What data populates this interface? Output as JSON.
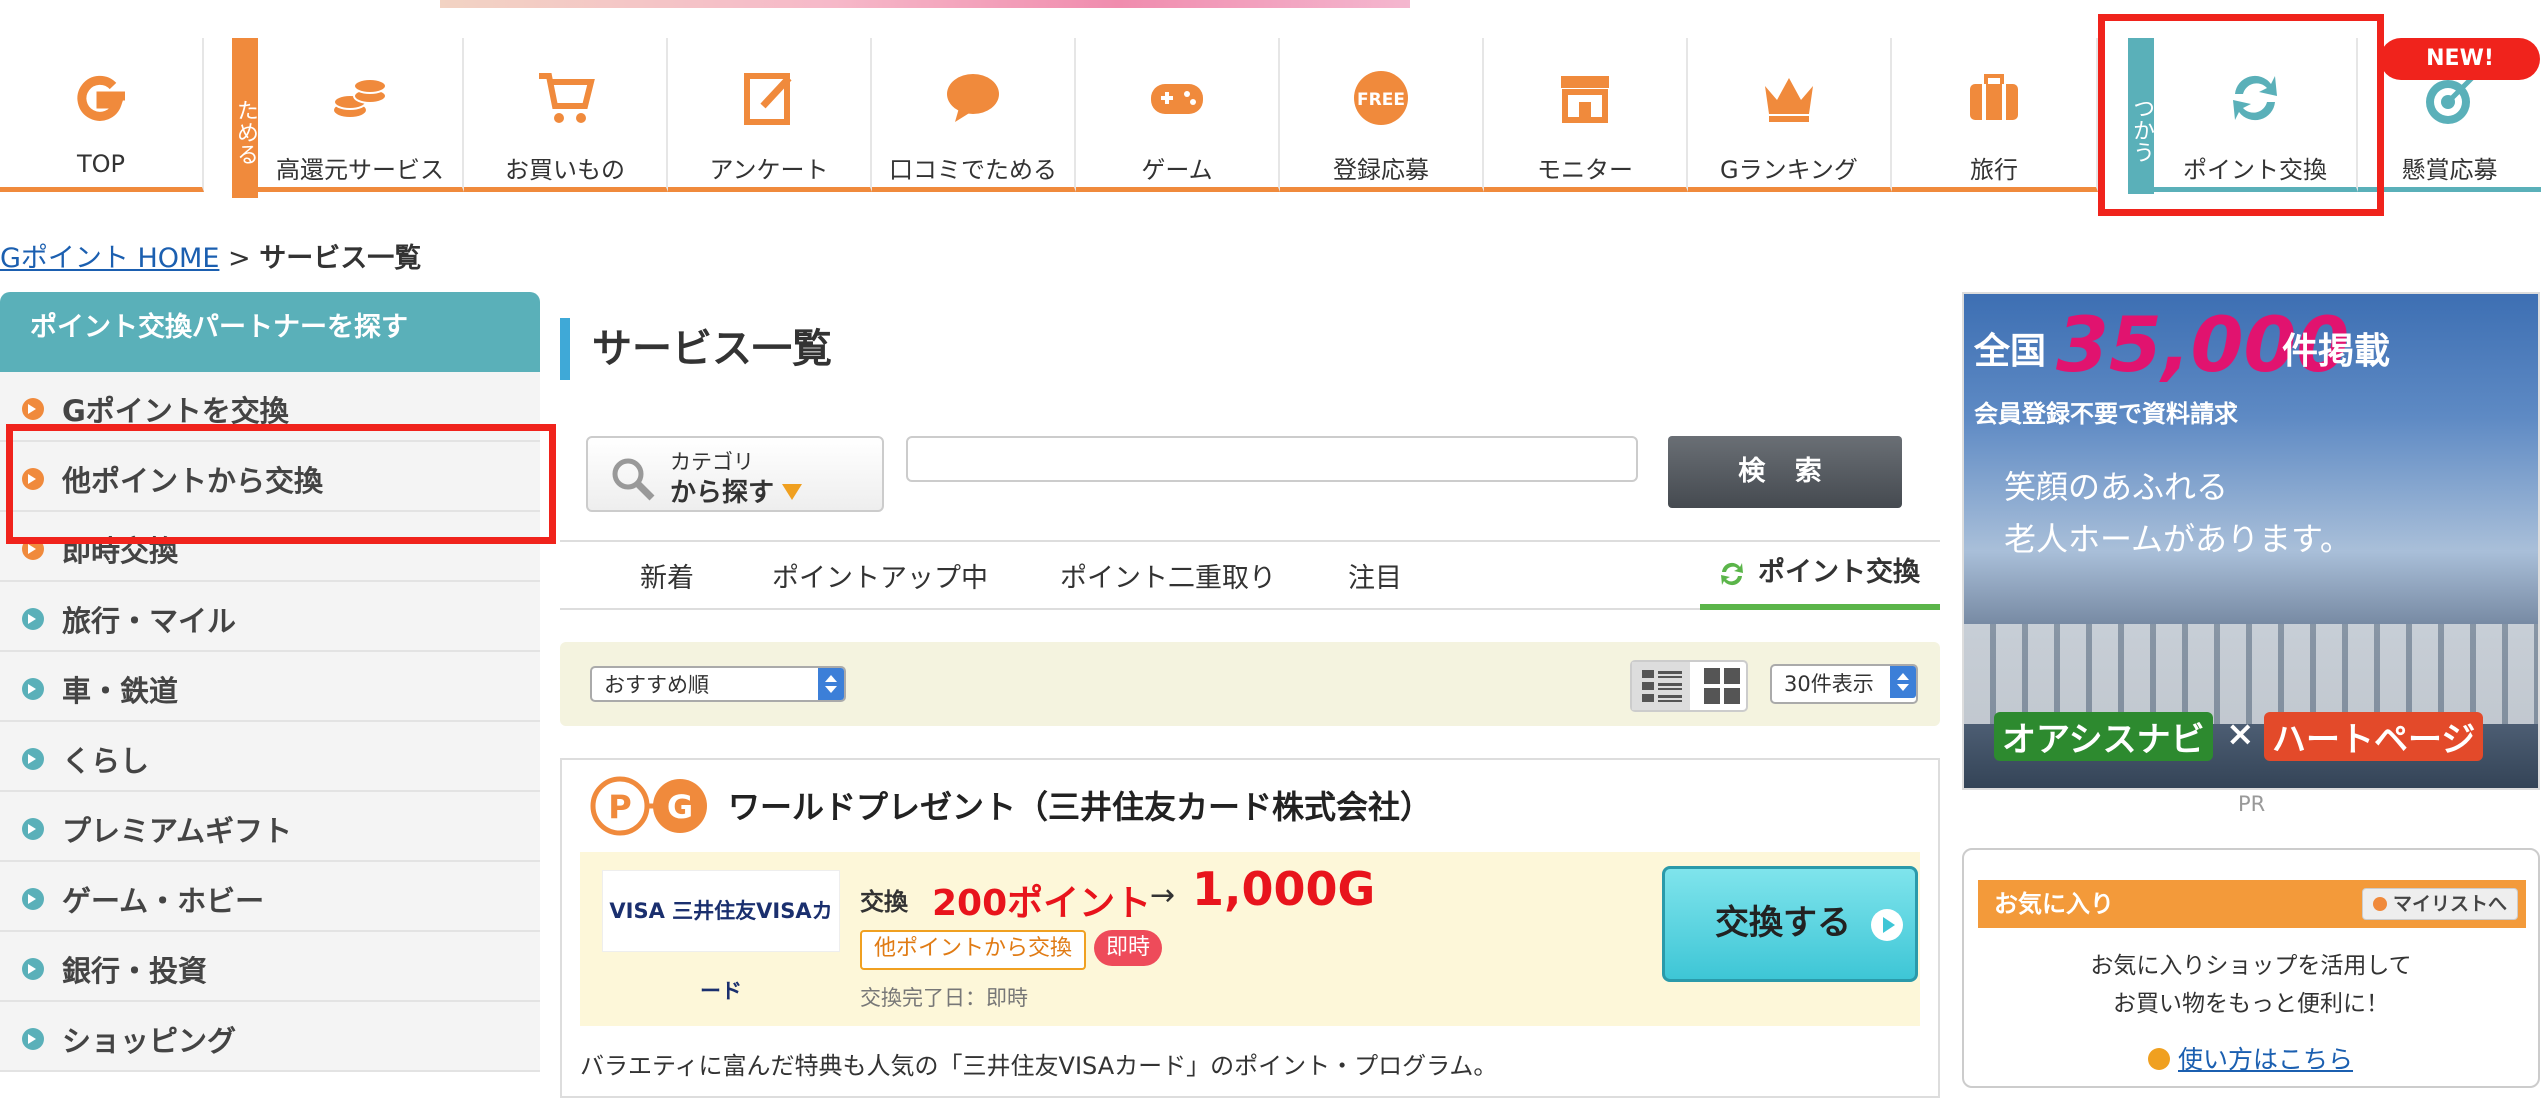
{
  "nav": {
    "top": "TOP",
    "tameru_tab": "ためる",
    "tsukau_tab": "つかう",
    "new_badge": "NEW!",
    "items": [
      {
        "label": "高還元サービス",
        "icon": "coins-icon"
      },
      {
        "label": "お買いもの",
        "icon": "cart-icon"
      },
      {
        "label": "アンケート",
        "icon": "survey-icon"
      },
      {
        "label": "口コミでためる",
        "icon": "speech-bubble-icon"
      },
      {
        "label": "ゲーム",
        "icon": "gamepad-icon"
      },
      {
        "label": "登録応募",
        "icon": "free-icon"
      },
      {
        "label": "モニター",
        "icon": "shop-icon"
      },
      {
        "label": "Gランキング",
        "icon": "crown-icon"
      },
      {
        "label": "旅行",
        "icon": "suitcase-icon"
      }
    ],
    "exchange": "ポイント交換",
    "prize": "懸賞応募",
    "free_text": "FREE"
  },
  "breadcrumb": {
    "home": "Gポイント HOME",
    "sep": " > ",
    "current": "サービス一覧"
  },
  "sidebar": {
    "header": "ポイント交換パートナーを探す",
    "items": [
      {
        "label": "Gポイントを交換",
        "color": "#f08a3c"
      },
      {
        "label": "他ポイントから交換",
        "color": "#f08a3c"
      },
      {
        "label": "即時交換",
        "color": "#f08a3c"
      },
      {
        "label": "旅行・マイル",
        "color": "#5ab0b9"
      },
      {
        "label": "車・鉄道",
        "color": "#5ab0b9"
      },
      {
        "label": "くらし",
        "color": "#5ab0b9"
      },
      {
        "label": "プレミアムギフト",
        "color": "#5ab0b9"
      },
      {
        "label": "ゲーム・ホビー",
        "color": "#5ab0b9"
      },
      {
        "label": "銀行・投資",
        "color": "#5ab0b9"
      },
      {
        "label": "ショッピング",
        "color": "#5ab0b9"
      }
    ]
  },
  "main": {
    "title": "サービス一覧",
    "category_line1": "カテゴリ",
    "category_line2": "から探す",
    "search_value": "",
    "search_button": "検 索",
    "tabs": [
      "新着",
      "ポイントアップ中",
      "ポイント二重取り",
      "注目"
    ],
    "active_tab": "ポイント交換",
    "sort_selected": "おすすめ順",
    "count_selected": "30件表示",
    "card": {
      "title": "ワールドプレゼント（三井住友カード株式会社）",
      "logo_text": "VISA 三井住友VISAカード",
      "exchange_label": "交換",
      "points": "200ポイント",
      "arrow": "→",
      "g_value": "1,000G",
      "tag_from": "他ポイントから交換",
      "tag_instant": "即時",
      "done_date": "交換完了日：即時",
      "button": "交換する",
      "description": "バラエティに富んだ特典も人気の「三井住友VISAカード」のポイント・プログラム。"
    }
  },
  "ad": {
    "zenkoku": "全国",
    "count": "35,000",
    "ken": "件掲載",
    "sub": "会員登録不要で資料請求",
    "copy1": "笑顔のあふれる",
    "copy2": "老人ホームがあります。",
    "brand1": "オアシスナビ",
    "times": "×",
    "brand2": "ハートページ",
    "pr": "PR"
  },
  "favorites": {
    "header": "お気に入り",
    "mylist": "マイリストへ",
    "line1": "お気に入りショップを活用して",
    "line2": "お買い物をもっと便利に！",
    "howto": "使い方はこちら"
  },
  "colors": {
    "accent_orange": "#f08a3c",
    "accent_teal": "#5ab0b9",
    "highlight_red": "#f0231c",
    "price_red": "#e8141c"
  }
}
